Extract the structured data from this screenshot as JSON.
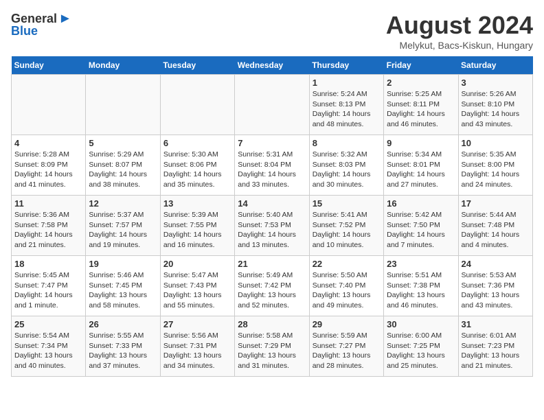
{
  "header": {
    "logo_general": "General",
    "logo_blue": "Blue",
    "month_title": "August 2024",
    "subtitle": "Melykut, Bacs-Kiskun, Hungary"
  },
  "days_of_week": [
    "Sunday",
    "Monday",
    "Tuesday",
    "Wednesday",
    "Thursday",
    "Friday",
    "Saturday"
  ],
  "weeks": [
    [
      {
        "day": "",
        "info": ""
      },
      {
        "day": "",
        "info": ""
      },
      {
        "day": "",
        "info": ""
      },
      {
        "day": "",
        "info": ""
      },
      {
        "day": "1",
        "info": "Sunrise: 5:24 AM\nSunset: 8:13 PM\nDaylight: 14 hours\nand 48 minutes."
      },
      {
        "day": "2",
        "info": "Sunrise: 5:25 AM\nSunset: 8:11 PM\nDaylight: 14 hours\nand 46 minutes."
      },
      {
        "day": "3",
        "info": "Sunrise: 5:26 AM\nSunset: 8:10 PM\nDaylight: 14 hours\nand 43 minutes."
      }
    ],
    [
      {
        "day": "4",
        "info": "Sunrise: 5:28 AM\nSunset: 8:09 PM\nDaylight: 14 hours\nand 41 minutes."
      },
      {
        "day": "5",
        "info": "Sunrise: 5:29 AM\nSunset: 8:07 PM\nDaylight: 14 hours\nand 38 minutes."
      },
      {
        "day": "6",
        "info": "Sunrise: 5:30 AM\nSunset: 8:06 PM\nDaylight: 14 hours\nand 35 minutes."
      },
      {
        "day": "7",
        "info": "Sunrise: 5:31 AM\nSunset: 8:04 PM\nDaylight: 14 hours\nand 33 minutes."
      },
      {
        "day": "8",
        "info": "Sunrise: 5:32 AM\nSunset: 8:03 PM\nDaylight: 14 hours\nand 30 minutes."
      },
      {
        "day": "9",
        "info": "Sunrise: 5:34 AM\nSunset: 8:01 PM\nDaylight: 14 hours\nand 27 minutes."
      },
      {
        "day": "10",
        "info": "Sunrise: 5:35 AM\nSunset: 8:00 PM\nDaylight: 14 hours\nand 24 minutes."
      }
    ],
    [
      {
        "day": "11",
        "info": "Sunrise: 5:36 AM\nSunset: 7:58 PM\nDaylight: 14 hours\nand 21 minutes."
      },
      {
        "day": "12",
        "info": "Sunrise: 5:37 AM\nSunset: 7:57 PM\nDaylight: 14 hours\nand 19 minutes."
      },
      {
        "day": "13",
        "info": "Sunrise: 5:39 AM\nSunset: 7:55 PM\nDaylight: 14 hours\nand 16 minutes."
      },
      {
        "day": "14",
        "info": "Sunrise: 5:40 AM\nSunset: 7:53 PM\nDaylight: 14 hours\nand 13 minutes."
      },
      {
        "day": "15",
        "info": "Sunrise: 5:41 AM\nSunset: 7:52 PM\nDaylight: 14 hours\nand 10 minutes."
      },
      {
        "day": "16",
        "info": "Sunrise: 5:42 AM\nSunset: 7:50 PM\nDaylight: 14 hours\nand 7 minutes."
      },
      {
        "day": "17",
        "info": "Sunrise: 5:44 AM\nSunset: 7:48 PM\nDaylight: 14 hours\nand 4 minutes."
      }
    ],
    [
      {
        "day": "18",
        "info": "Sunrise: 5:45 AM\nSunset: 7:47 PM\nDaylight: 14 hours\nand 1 minute."
      },
      {
        "day": "19",
        "info": "Sunrise: 5:46 AM\nSunset: 7:45 PM\nDaylight: 13 hours\nand 58 minutes."
      },
      {
        "day": "20",
        "info": "Sunrise: 5:47 AM\nSunset: 7:43 PM\nDaylight: 13 hours\nand 55 minutes."
      },
      {
        "day": "21",
        "info": "Sunrise: 5:49 AM\nSunset: 7:42 PM\nDaylight: 13 hours\nand 52 minutes."
      },
      {
        "day": "22",
        "info": "Sunrise: 5:50 AM\nSunset: 7:40 PM\nDaylight: 13 hours\nand 49 minutes."
      },
      {
        "day": "23",
        "info": "Sunrise: 5:51 AM\nSunset: 7:38 PM\nDaylight: 13 hours\nand 46 minutes."
      },
      {
        "day": "24",
        "info": "Sunrise: 5:53 AM\nSunset: 7:36 PM\nDaylight: 13 hours\nand 43 minutes."
      }
    ],
    [
      {
        "day": "25",
        "info": "Sunrise: 5:54 AM\nSunset: 7:34 PM\nDaylight: 13 hours\nand 40 minutes."
      },
      {
        "day": "26",
        "info": "Sunrise: 5:55 AM\nSunset: 7:33 PM\nDaylight: 13 hours\nand 37 minutes."
      },
      {
        "day": "27",
        "info": "Sunrise: 5:56 AM\nSunset: 7:31 PM\nDaylight: 13 hours\nand 34 minutes."
      },
      {
        "day": "28",
        "info": "Sunrise: 5:58 AM\nSunset: 7:29 PM\nDaylight: 13 hours\nand 31 minutes."
      },
      {
        "day": "29",
        "info": "Sunrise: 5:59 AM\nSunset: 7:27 PM\nDaylight: 13 hours\nand 28 minutes."
      },
      {
        "day": "30",
        "info": "Sunrise: 6:00 AM\nSunset: 7:25 PM\nDaylight: 13 hours\nand 25 minutes."
      },
      {
        "day": "31",
        "info": "Sunrise: 6:01 AM\nSunset: 7:23 PM\nDaylight: 13 hours\nand 21 minutes."
      }
    ]
  ]
}
